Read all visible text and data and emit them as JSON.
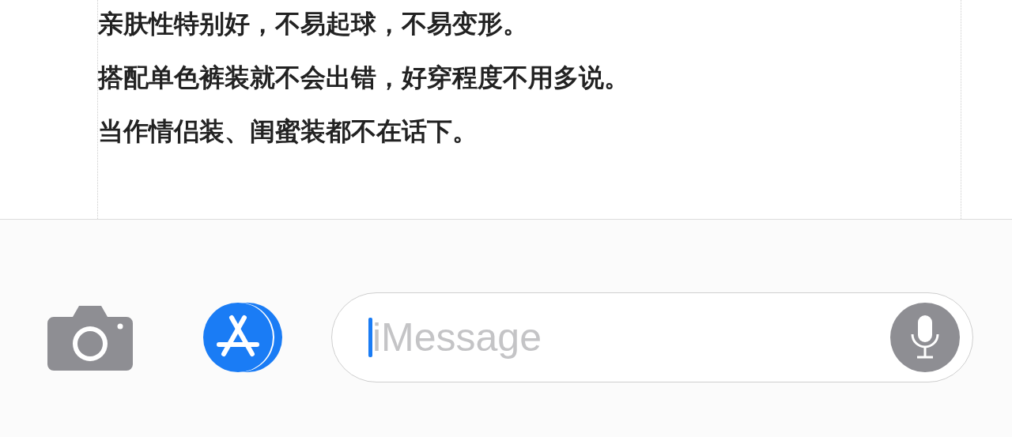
{
  "description": {
    "lines": [
      "亲肤性特别好，不易起球，不易变形。",
      "搭配单色裤装就不会出错，好穿程度不用多说。",
      "当作情侣装、闺蜜装都不在话下。"
    ]
  },
  "message_bar": {
    "placeholder": "iMessage"
  }
}
